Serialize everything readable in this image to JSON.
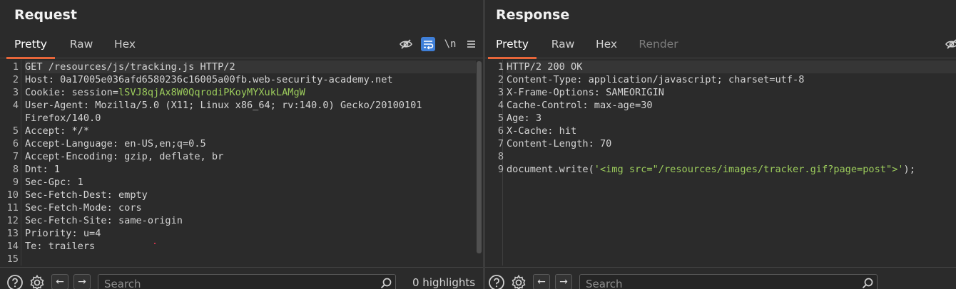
{
  "request": {
    "title": "Request",
    "tabs": [
      "Pretty",
      "Raw",
      "Hex"
    ],
    "active_tab": "Pretty",
    "line_numbers": [
      "1",
      "2",
      "3",
      "4",
      "",
      "5",
      "6",
      "7",
      "8",
      "9",
      "10",
      "11",
      "12",
      "13",
      "14",
      "15"
    ],
    "lines": [
      {
        "text": "GET /resources/js/tracking.js HTTP/2"
      },
      {
        "text": "Host: 0a17005e036afd6580236c16005a00fb.web-security-academy.net"
      },
      {
        "key": "Cookie: session=",
        "value": "lSVJ8qjAx8W0QqrodiPKoyMYXukLAMgW"
      },
      {
        "text": "User-Agent: Mozilla/5.0 (X11; Linux x86_64; rv:140.0) Gecko/20100101"
      },
      {
        "text": "Firefox/140.0"
      },
      {
        "text": "Accept: */*"
      },
      {
        "text": "Accept-Language: en-US,en;q=0.5"
      },
      {
        "text": "Accept-Encoding: gzip, deflate, br"
      },
      {
        "text": "Dnt: 1"
      },
      {
        "text": "Sec-Gpc: 1"
      },
      {
        "text": "Sec-Fetch-Dest: empty"
      },
      {
        "text": "Sec-Fetch-Mode: cors"
      },
      {
        "text": "Sec-Fetch-Site: same-origin"
      },
      {
        "text": "Priority: u=4"
      },
      {
        "text": "Te: trailers"
      },
      {
        "text": ""
      }
    ],
    "search_placeholder": "Search",
    "highlights": "0 highlights"
  },
  "response": {
    "title": "Response",
    "tabs": [
      "Pretty",
      "Raw",
      "Hex",
      "Render"
    ],
    "active_tab": "Pretty",
    "line_numbers": [
      "1",
      "2",
      "3",
      "4",
      "5",
      "6",
      "7",
      "8",
      "9"
    ],
    "lines": [
      {
        "text": "HTTP/2 200 OK"
      },
      {
        "text": "Content-Type: application/javascript; charset=utf-8"
      },
      {
        "text": "X-Frame-Options: SAMEORIGIN"
      },
      {
        "text": "Cache-Control: max-age=30"
      },
      {
        "text": "Age: 3"
      },
      {
        "text": "X-Cache: hit"
      },
      {
        "text": "Content-Length: 70"
      },
      {
        "text": ""
      },
      {
        "pre": "document.write(",
        "str": "'<img src=\"/resources/images/tracker.gif?page=post\">'",
        "post": ");"
      }
    ],
    "search_placeholder": "Search"
  },
  "icons": {
    "hide": "eye-slash-icon",
    "wrap": "word-wrap-icon",
    "newline": "\\n",
    "menu": "menu-icon",
    "help": "help-icon",
    "settings": "gear-icon",
    "back": "←",
    "forward": "→",
    "search": "search-icon"
  },
  "colors": {
    "accent": "#e8663a",
    "value_green": "#9ccc5c",
    "active_tool": "#3f7fd8",
    "background": "#2b2b2b"
  }
}
